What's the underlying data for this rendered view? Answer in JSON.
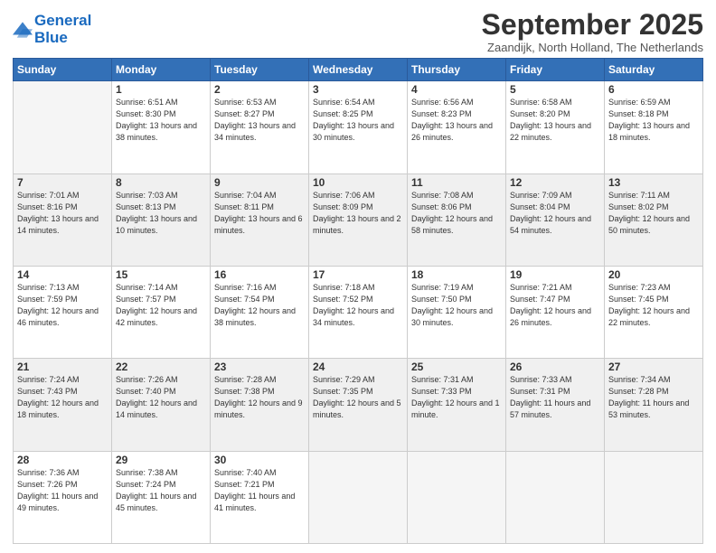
{
  "logo": {
    "line1": "General",
    "line2": "Blue"
  },
  "header": {
    "title": "September 2025",
    "subtitle": "Zaandijk, North Holland, The Netherlands"
  },
  "weekdays": [
    "Sunday",
    "Monday",
    "Tuesday",
    "Wednesday",
    "Thursday",
    "Friday",
    "Saturday"
  ],
  "weeks": [
    [
      {
        "day": "",
        "empty": true
      },
      {
        "day": "1",
        "sunrise": "Sunrise: 6:51 AM",
        "sunset": "Sunset: 8:30 PM",
        "daylight": "Daylight: 13 hours and 38 minutes."
      },
      {
        "day": "2",
        "sunrise": "Sunrise: 6:53 AM",
        "sunset": "Sunset: 8:27 PM",
        "daylight": "Daylight: 13 hours and 34 minutes."
      },
      {
        "day": "3",
        "sunrise": "Sunrise: 6:54 AM",
        "sunset": "Sunset: 8:25 PM",
        "daylight": "Daylight: 13 hours and 30 minutes."
      },
      {
        "day": "4",
        "sunrise": "Sunrise: 6:56 AM",
        "sunset": "Sunset: 8:23 PM",
        "daylight": "Daylight: 13 hours and 26 minutes."
      },
      {
        "day": "5",
        "sunrise": "Sunrise: 6:58 AM",
        "sunset": "Sunset: 8:20 PM",
        "daylight": "Daylight: 13 hours and 22 minutes."
      },
      {
        "day": "6",
        "sunrise": "Sunrise: 6:59 AM",
        "sunset": "Sunset: 8:18 PM",
        "daylight": "Daylight: 13 hours and 18 minutes."
      }
    ],
    [
      {
        "day": "7",
        "sunrise": "Sunrise: 7:01 AM",
        "sunset": "Sunset: 8:16 PM",
        "daylight": "Daylight: 13 hours and 14 minutes."
      },
      {
        "day": "8",
        "sunrise": "Sunrise: 7:03 AM",
        "sunset": "Sunset: 8:13 PM",
        "daylight": "Daylight: 13 hours and 10 minutes."
      },
      {
        "day": "9",
        "sunrise": "Sunrise: 7:04 AM",
        "sunset": "Sunset: 8:11 PM",
        "daylight": "Daylight: 13 hours and 6 minutes."
      },
      {
        "day": "10",
        "sunrise": "Sunrise: 7:06 AM",
        "sunset": "Sunset: 8:09 PM",
        "daylight": "Daylight: 13 hours and 2 minutes."
      },
      {
        "day": "11",
        "sunrise": "Sunrise: 7:08 AM",
        "sunset": "Sunset: 8:06 PM",
        "daylight": "Daylight: 12 hours and 58 minutes."
      },
      {
        "day": "12",
        "sunrise": "Sunrise: 7:09 AM",
        "sunset": "Sunset: 8:04 PM",
        "daylight": "Daylight: 12 hours and 54 minutes."
      },
      {
        "day": "13",
        "sunrise": "Sunrise: 7:11 AM",
        "sunset": "Sunset: 8:02 PM",
        "daylight": "Daylight: 12 hours and 50 minutes."
      }
    ],
    [
      {
        "day": "14",
        "sunrise": "Sunrise: 7:13 AM",
        "sunset": "Sunset: 7:59 PM",
        "daylight": "Daylight: 12 hours and 46 minutes."
      },
      {
        "day": "15",
        "sunrise": "Sunrise: 7:14 AM",
        "sunset": "Sunset: 7:57 PM",
        "daylight": "Daylight: 12 hours and 42 minutes."
      },
      {
        "day": "16",
        "sunrise": "Sunrise: 7:16 AM",
        "sunset": "Sunset: 7:54 PM",
        "daylight": "Daylight: 12 hours and 38 minutes."
      },
      {
        "day": "17",
        "sunrise": "Sunrise: 7:18 AM",
        "sunset": "Sunset: 7:52 PM",
        "daylight": "Daylight: 12 hours and 34 minutes."
      },
      {
        "day": "18",
        "sunrise": "Sunrise: 7:19 AM",
        "sunset": "Sunset: 7:50 PM",
        "daylight": "Daylight: 12 hours and 30 minutes."
      },
      {
        "day": "19",
        "sunrise": "Sunrise: 7:21 AM",
        "sunset": "Sunset: 7:47 PM",
        "daylight": "Daylight: 12 hours and 26 minutes."
      },
      {
        "day": "20",
        "sunrise": "Sunrise: 7:23 AM",
        "sunset": "Sunset: 7:45 PM",
        "daylight": "Daylight: 12 hours and 22 minutes."
      }
    ],
    [
      {
        "day": "21",
        "sunrise": "Sunrise: 7:24 AM",
        "sunset": "Sunset: 7:43 PM",
        "daylight": "Daylight: 12 hours and 18 minutes."
      },
      {
        "day": "22",
        "sunrise": "Sunrise: 7:26 AM",
        "sunset": "Sunset: 7:40 PM",
        "daylight": "Daylight: 12 hours and 14 minutes."
      },
      {
        "day": "23",
        "sunrise": "Sunrise: 7:28 AM",
        "sunset": "Sunset: 7:38 PM",
        "daylight": "Daylight: 12 hours and 9 minutes."
      },
      {
        "day": "24",
        "sunrise": "Sunrise: 7:29 AM",
        "sunset": "Sunset: 7:35 PM",
        "daylight": "Daylight: 12 hours and 5 minutes."
      },
      {
        "day": "25",
        "sunrise": "Sunrise: 7:31 AM",
        "sunset": "Sunset: 7:33 PM",
        "daylight": "Daylight: 12 hours and 1 minute."
      },
      {
        "day": "26",
        "sunrise": "Sunrise: 7:33 AM",
        "sunset": "Sunset: 7:31 PM",
        "daylight": "Daylight: 11 hours and 57 minutes."
      },
      {
        "day": "27",
        "sunrise": "Sunrise: 7:34 AM",
        "sunset": "Sunset: 7:28 PM",
        "daylight": "Daylight: 11 hours and 53 minutes."
      }
    ],
    [
      {
        "day": "28",
        "sunrise": "Sunrise: 7:36 AM",
        "sunset": "Sunset: 7:26 PM",
        "daylight": "Daylight: 11 hours and 49 minutes."
      },
      {
        "day": "29",
        "sunrise": "Sunrise: 7:38 AM",
        "sunset": "Sunset: 7:24 PM",
        "daylight": "Daylight: 11 hours and 45 minutes."
      },
      {
        "day": "30",
        "sunrise": "Sunrise: 7:40 AM",
        "sunset": "Sunset: 7:21 PM",
        "daylight": "Daylight: 11 hours and 41 minutes."
      },
      {
        "day": "",
        "empty": true
      },
      {
        "day": "",
        "empty": true
      },
      {
        "day": "",
        "empty": true
      },
      {
        "day": "",
        "empty": true
      }
    ]
  ]
}
